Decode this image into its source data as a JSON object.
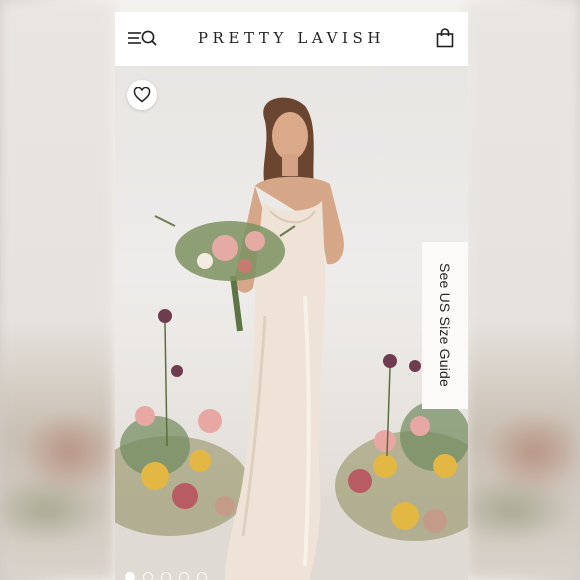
{
  "header": {
    "brand": "PRETTY LAVISH",
    "menu_icon": "menu-icon",
    "search_icon": "search-icon",
    "bag_icon": "shopping-bag-icon"
  },
  "product": {
    "favorite_icon": "heart-icon",
    "size_guide_label": "See US Size Guide",
    "carousel": {
      "total": 5,
      "active_index": 0
    }
  },
  "colors": {
    "header_bg": "#ffffff",
    "brand_text": "#222222",
    "dress": "#eee3d6",
    "backdrop": "#ebe9e6"
  }
}
